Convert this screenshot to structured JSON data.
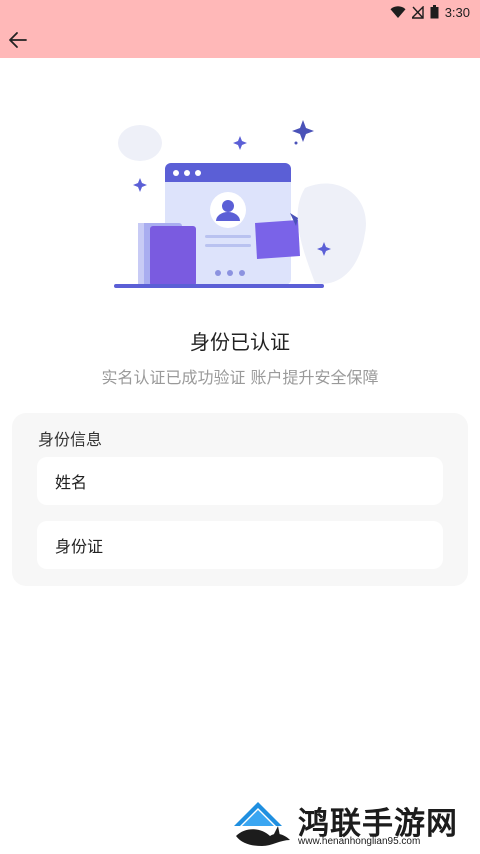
{
  "status_bar": {
    "time": "3:30"
  },
  "header": {
    "back_icon": "arrow-left-icon",
    "background": "#ffb8b8"
  },
  "hero": {
    "title": "身份已认证",
    "subtitle": "实名认证已成功验证 账户提升安全保障"
  },
  "identity_card": {
    "heading": "身份信息",
    "name_label": "姓名",
    "id_label": "身份证"
  },
  "watermark": {
    "title": "鸿联手游网",
    "url": "www.henanhonglian95.com"
  },
  "colors": {
    "accent": "#5b5fd6",
    "card_bg": "#f7f7f7",
    "subtitle": "#9a9a9a"
  }
}
